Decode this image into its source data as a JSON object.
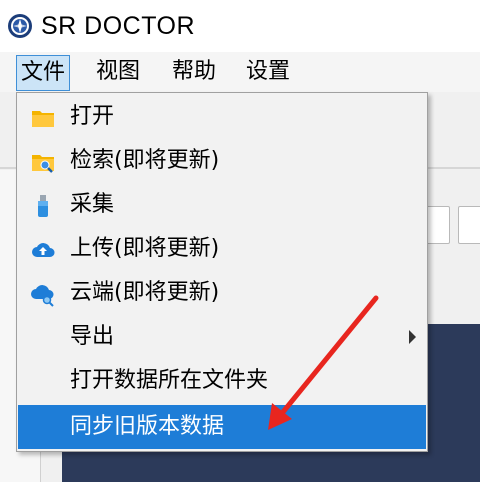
{
  "app": {
    "title": "SR DOCTOR",
    "logo_icon": "steering-wheel-logo-icon"
  },
  "menubar": {
    "items": [
      {
        "label": "文件",
        "active": true
      },
      {
        "label": "视图",
        "active": false
      },
      {
        "label": "帮助",
        "active": false
      },
      {
        "label": "设置",
        "active": false
      }
    ]
  },
  "file_menu": {
    "items": [
      {
        "label": "打开",
        "icon": "folder-icon"
      },
      {
        "label": "检索(即将更新)",
        "icon": "folder-search-icon"
      },
      {
        "label": "采集",
        "icon": "usb-drive-icon"
      },
      {
        "label": "上传(即将更新)",
        "icon": "cloud-upload-icon"
      },
      {
        "label": "云端(即将更新)",
        "icon": "cloud-search-icon"
      },
      {
        "label": "导出",
        "icon": "",
        "has_submenu": true
      },
      {
        "label": "打开数据所在文件夹",
        "icon": ""
      },
      {
        "label": "同步旧版本数据",
        "icon": "",
        "highlighted": true
      }
    ]
  },
  "colors": {
    "highlight": "#1e7dd7",
    "menu_active_bg": "#cce4f7",
    "annotation_arrow": "#e8261f",
    "dark_panel": "#2c3a5a"
  }
}
